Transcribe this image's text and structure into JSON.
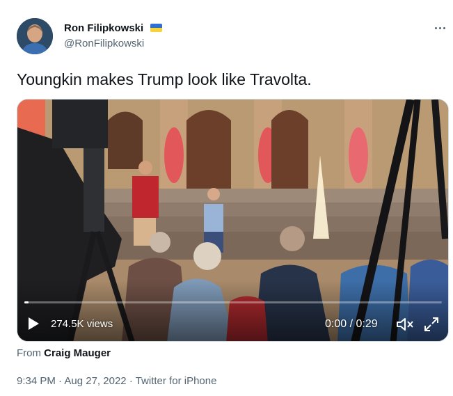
{
  "author": {
    "display_name": "Ron Filipkowski",
    "handle": "@RonFilipkowski",
    "flag_icon": "ukraine-flag-icon"
  },
  "tweet": {
    "text": "Youngkin makes Trump look like Travolta."
  },
  "video": {
    "views": "274.5K views",
    "time": "0:00 / 0:29",
    "progress": 0.0,
    "play_icon": "play-icon",
    "volume_icon": "volume-icon",
    "fullscreen_icon": "fullscreen-icon"
  },
  "source": {
    "prefix": "From",
    "name": "Craig Mauger"
  },
  "meta": {
    "time": "9:34 PM",
    "sep1": "·",
    "date": "Aug 27, 2022",
    "sep2": "·",
    "client": "Twitter for iPhone"
  },
  "colors": {
    "text_primary": "#0f1419",
    "text_secondary": "#536471"
  }
}
